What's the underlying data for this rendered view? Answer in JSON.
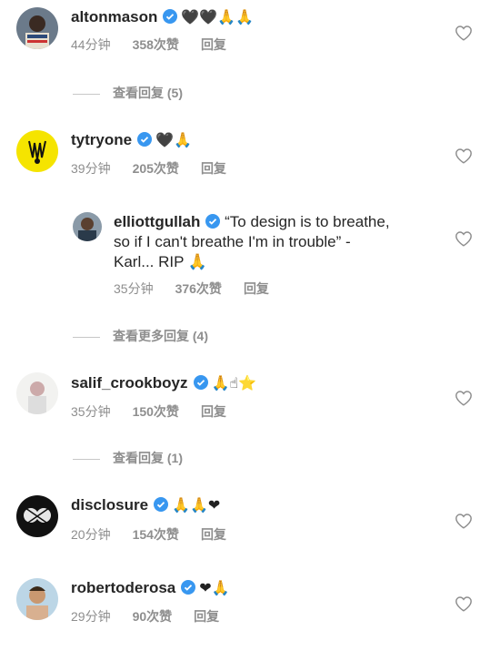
{
  "comments": [
    {
      "username": "altonmason",
      "emoji": "🖤🖤🙏🙏",
      "time": "44分钟",
      "likes": "358次赞",
      "reply": "回复"
    },
    {
      "username": "tytryone",
      "emoji": "🖤🙏",
      "time": "39分钟",
      "likes": "205次赞",
      "reply": "回复"
    },
    {
      "username": "elliottgullah",
      "text_line1": "“To design is to breathe,",
      "text_line2": "so if I can't breathe I'm in trouble” -",
      "text_line3": "Karl... RIP 🙏",
      "time": "35分钟",
      "likes": "376次赞",
      "reply": "回复"
    },
    {
      "username": "salif_crookboyz",
      "emoji": "🙏☝⭐",
      "time": "35分钟",
      "likes": "150次赞",
      "reply": "回复"
    },
    {
      "username": "disclosure",
      "emoji": "🙏🙏❤",
      "time": "20分钟",
      "likes": "154次赞",
      "reply": "回复"
    },
    {
      "username": "robertoderosa",
      "emoji": "❤🙏",
      "time": "29分钟",
      "likes": "90次赞",
      "reply": "回复"
    }
  ],
  "view_replies": [
    "查看回复 (5)",
    "查看更多回复 (4)",
    "查看回复 (1)"
  ],
  "colors": {
    "verified": "#3897f0",
    "meta": "#8e8e8e",
    "text": "#262626"
  }
}
